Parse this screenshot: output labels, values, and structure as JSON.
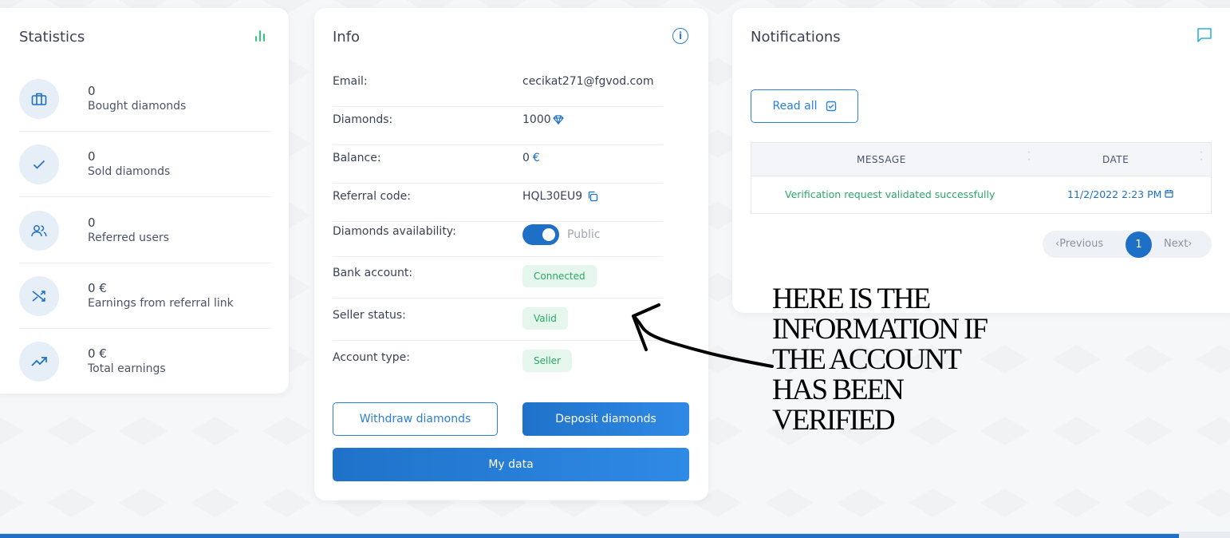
{
  "statistics": {
    "title": "Statistics",
    "items": [
      {
        "value": "0",
        "label": "Bought diamonds",
        "icon": "bag-icon"
      },
      {
        "value": "0",
        "label": "Sold diamonds",
        "icon": "check-icon"
      },
      {
        "value": "0",
        "label": "Referred users",
        "icon": "users-icon"
      },
      {
        "value": "0 €",
        "label": "Earnings from referral link",
        "icon": "shuffle-icon"
      },
      {
        "value": "0 €",
        "label": "Total earnings",
        "icon": "trending-up-icon"
      }
    ]
  },
  "info": {
    "title": "Info",
    "rows": {
      "email": {
        "label": "Email:",
        "value": "cecikat271@fgvod.com"
      },
      "diamonds": {
        "label": "Diamonds:",
        "value": "1000"
      },
      "balance": {
        "label": "Balance:",
        "value": "0",
        "currency": "€"
      },
      "referral": {
        "label": "Referral code:",
        "value": "HQL30EU9"
      },
      "availability": {
        "label": "Diamonds availability:",
        "value": "Public"
      },
      "bank": {
        "label": "Bank account:",
        "value": "Connected"
      },
      "seller": {
        "label": "Seller status:",
        "value": "Valid"
      },
      "type": {
        "label": "Account type:",
        "value": "Seller"
      }
    },
    "withdraw_label": "Withdraw diamonds",
    "deposit_label": "Deposit diamonds",
    "mydata_label": "My data"
  },
  "notifications": {
    "title": "Notifications",
    "read_all_label": "Read all",
    "columns": {
      "message": "MESSAGE",
      "date": "DATE"
    },
    "rows": [
      {
        "message": "Verification request validated successfully",
        "date": "11/2/2022 2:23 PM"
      }
    ],
    "pager": {
      "prev": "Previous",
      "current": "1",
      "next": "Next"
    }
  },
  "annotation": {
    "line1": "HERE IS THE",
    "line2": "INFORMATION IF",
    "line3": "THE ACCOUNT",
    "line4": "HAS BEEN",
    "line5": "VERIFIED"
  },
  "colors": {
    "primary": "#1e6fc6",
    "success": "#2aa866",
    "success_bg": "#e5f6ec",
    "chart_icon": "#2ec97a"
  }
}
